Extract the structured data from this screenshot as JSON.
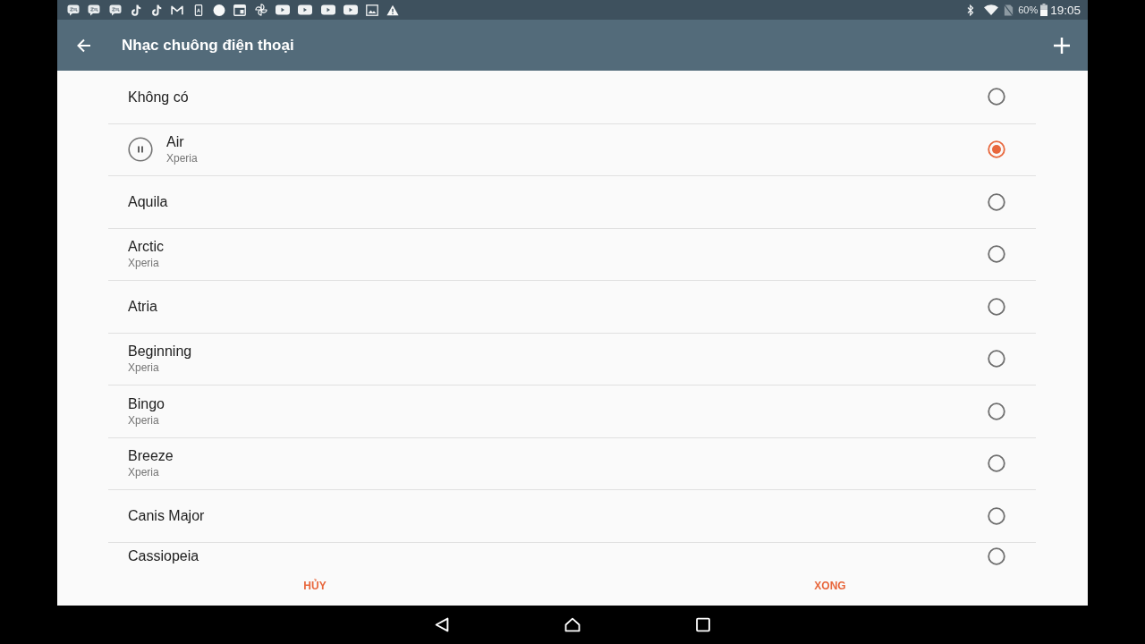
{
  "status_bar": {
    "battery": "60%",
    "time": "19:05"
  },
  "app_bar": {
    "title": "Nhạc chuông điện thoại"
  },
  "ringtones": [
    {
      "title": "Không có",
      "selected": false,
      "playing": false
    },
    {
      "title": "Air",
      "subtitle": "Xperia",
      "selected": true,
      "playing": true
    },
    {
      "title": "Aquila",
      "selected": false,
      "playing": false
    },
    {
      "title": "Arctic",
      "subtitle": "Xperia",
      "selected": false,
      "playing": false
    },
    {
      "title": "Atria",
      "selected": false,
      "playing": false
    },
    {
      "title": "Beginning",
      "subtitle": "Xperia",
      "selected": false,
      "playing": false
    },
    {
      "title": "Bingo",
      "subtitle": "Xperia",
      "selected": false,
      "playing": false
    },
    {
      "title": "Breeze",
      "subtitle": "Xperia",
      "selected": false,
      "playing": false
    },
    {
      "title": "Canis Major",
      "selected": false,
      "playing": false
    },
    {
      "title": "Cassiopeia",
      "selected": false,
      "playing": false
    }
  ],
  "footer_buttons": [
    "HỦY",
    "XONG"
  ]
}
